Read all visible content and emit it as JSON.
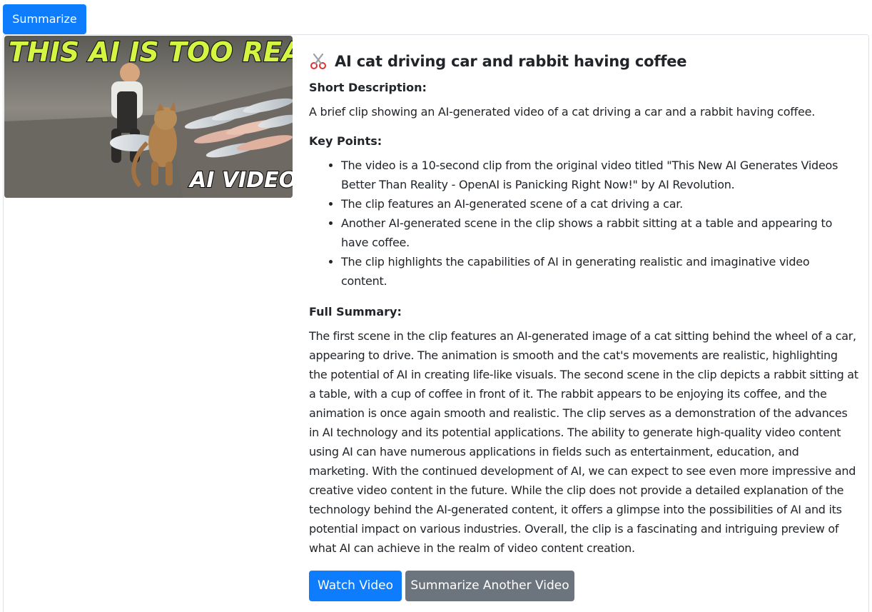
{
  "top": {
    "summarize_label": "Summarize"
  },
  "thumbnail": {
    "headline_text": "THIS AI IS TOO REAL",
    "badge_text": "AI VIDEO"
  },
  "result": {
    "title": "AI cat driving car and rabbit having coffee",
    "title_icon": "scissors-icon",
    "short_description_label": "Short Description:",
    "short_description": "A brief clip showing an AI-generated video of a cat driving a car and a rabbit having coffee.",
    "key_points_label": "Key Points:",
    "key_points": [
      "The video is a 10-second clip from the original video titled \"This New AI Generates Videos Better Than Reality - OpenAI is Panicking Right Now!\" by AI Revolution.",
      "The clip features an AI-generated scene of a cat driving a car.",
      "Another AI-generated scene in the clip shows a rabbit sitting at a table and appearing to have coffee.",
      "The clip highlights the capabilities of AI in generating realistic and imaginative video content."
    ],
    "full_summary_label": "Full Summary:",
    "full_summary": "The first scene in the clip features an AI-generated image of a cat sitting behind the wheel of a car, appearing to drive. The animation is smooth and the cat's movements are realistic, highlighting the potential of AI in creating life-like visuals. The second scene in the clip depicts a rabbit sitting at a table, with a cup of coffee in front of it. The rabbit appears to be enjoying its coffee, and the animation is once again smooth and realistic. The clip serves as a demonstration of the advances in AI technology and its potential applications. The ability to generate high-quality video content using AI can have numerous applications in fields such as entertainment, education, and marketing. With the continued development of AI, we can expect to see even more impressive and creative video content in the future. While the clip does not provide a detailed explanation of the technology behind the AI-generated content, it offers a glimpse into the possibilities of AI and its potential impact on various industries. Overall, the clip is a fascinating and intriguing preview of what AI can achieve in the realm of video content creation."
  },
  "actions": {
    "watch_label": "Watch Video",
    "another_label": "Summarize Another Video"
  },
  "colors": {
    "primary": "#0d7dfd",
    "secondary": "#6c757d",
    "headline_yellow": "#d4f542"
  }
}
